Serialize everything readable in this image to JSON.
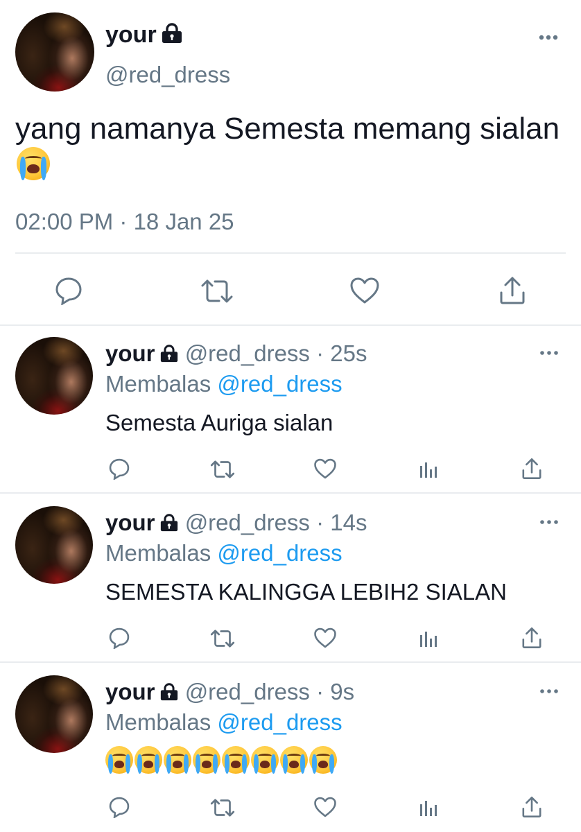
{
  "main_tweet": {
    "display_name": "your",
    "handle": "@red_dress",
    "text": "yang namanya Semesta memang sialan",
    "timestamp": "02:00 PM · 18 Jan 25",
    "icons": [
      "reply-icon",
      "retweet-icon",
      "like-icon",
      "share-icon"
    ]
  },
  "replies": [
    {
      "display_name": "your",
      "handle": "@red_dress",
      "time": "· 25s",
      "reply_prefix": "Membalas",
      "reply_to": "@red_dress",
      "text": "Semesta Auriga sialan",
      "emoji_count": 0
    },
    {
      "display_name": "your",
      "handle": "@red_dress",
      "time": "· 14s",
      "reply_prefix": "Membalas",
      "reply_to": "@red_dress",
      "text": "SEMESTA KALINGGA LEBIH2 SIALAN",
      "emoji_count": 0
    },
    {
      "display_name": "your",
      "handle": "@red_dress",
      "time": "· 9s",
      "reply_prefix": "Membalas",
      "reply_to": "@red_dress",
      "text": "",
      "emoji_count": 8
    }
  ],
  "colors": {
    "text": "#141823",
    "muted": "#657786",
    "link": "#1d9bf0",
    "divider": "#e9ecef"
  }
}
